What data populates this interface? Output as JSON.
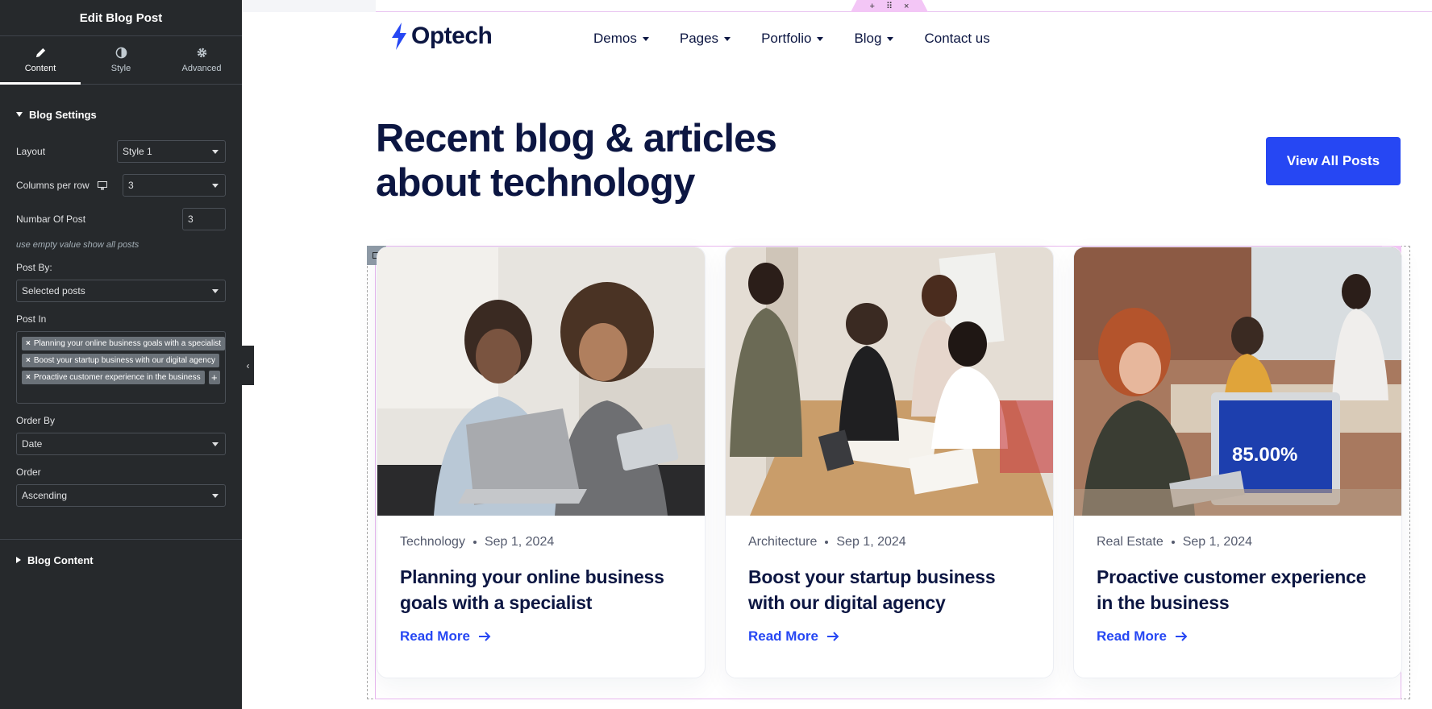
{
  "panel": {
    "title": "Edit Blog Post",
    "tabs": [
      {
        "label": "Content",
        "icon": "pencil-icon",
        "active": true
      },
      {
        "label": "Style",
        "icon": "contrast-icon",
        "active": false
      },
      {
        "label": "Advanced",
        "icon": "gear-icon",
        "active": false
      }
    ],
    "blog_settings": {
      "title": "Blog Settings",
      "layout_label": "Layout",
      "layout_value": "Style 1",
      "columns_label": "Columns per row",
      "columns_value": "3",
      "number_label": "Numbar Of Post",
      "number_value": "3",
      "number_help": "use empty value show all posts",
      "post_by_label": "Post By:",
      "post_by_value": "Selected posts",
      "post_in_label": "Post In",
      "post_in_items": [
        "Planning your online business goals with a specialist",
        "Boost your startup business with our digital agency",
        "Proactive customer experience in the business"
      ],
      "order_by_label": "Order By",
      "order_by_value": "Date",
      "order_label": "Order",
      "order_value": "Ascending"
    },
    "blog_content": {
      "title": "Blog Content"
    }
  },
  "handle": {
    "add": "+",
    "move": "⠿",
    "close": "×"
  },
  "site": {
    "logo_text": "Optech",
    "nav": [
      "Demos",
      "Pages",
      "Portfolio",
      "Blog",
      "Contact us"
    ],
    "nav_dropdowns": [
      true,
      true,
      true,
      true,
      false
    ],
    "headline": "Recent blog & articles about technology",
    "cta_label": "View All Posts",
    "accent_color": "#2647f3",
    "heading_color": "#0c1642"
  },
  "posts": [
    {
      "category": "Technology",
      "date": "Sep 1, 2024",
      "title": "Planning your online business goals with a specialist",
      "read_more": "Read More"
    },
    {
      "category": "Architecture",
      "date": "Sep 1, 2024",
      "title": "Boost your startup business with our digital agency",
      "read_more": "Read More"
    },
    {
      "category": "Real Estate",
      "date": "Sep 1, 2024",
      "title": "Proactive customer experience in the business",
      "read_more": "Read More"
    }
  ]
}
